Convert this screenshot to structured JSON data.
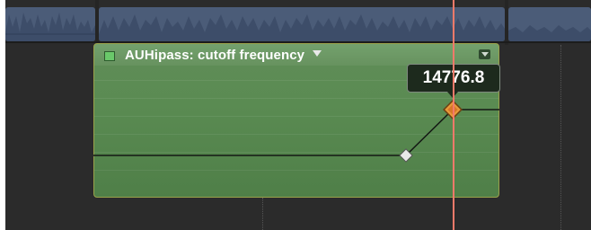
{
  "automation": {
    "parameter_title": "AUHipass: cutoff frequency",
    "checkbox_checked": true,
    "current_value": "14776.8"
  },
  "colors": {
    "panel": "#5a8b52",
    "waveform": "#4b5c78",
    "playhead": "#f27a6a",
    "keyframe_selected": "#e89a3a",
    "keyframe": "#e8e8e8"
  },
  "icons": {
    "parameter_menu": "triangle-down-icon",
    "panel_collapse": "triangle-down-icon",
    "keyframe": "diamond-icon"
  }
}
